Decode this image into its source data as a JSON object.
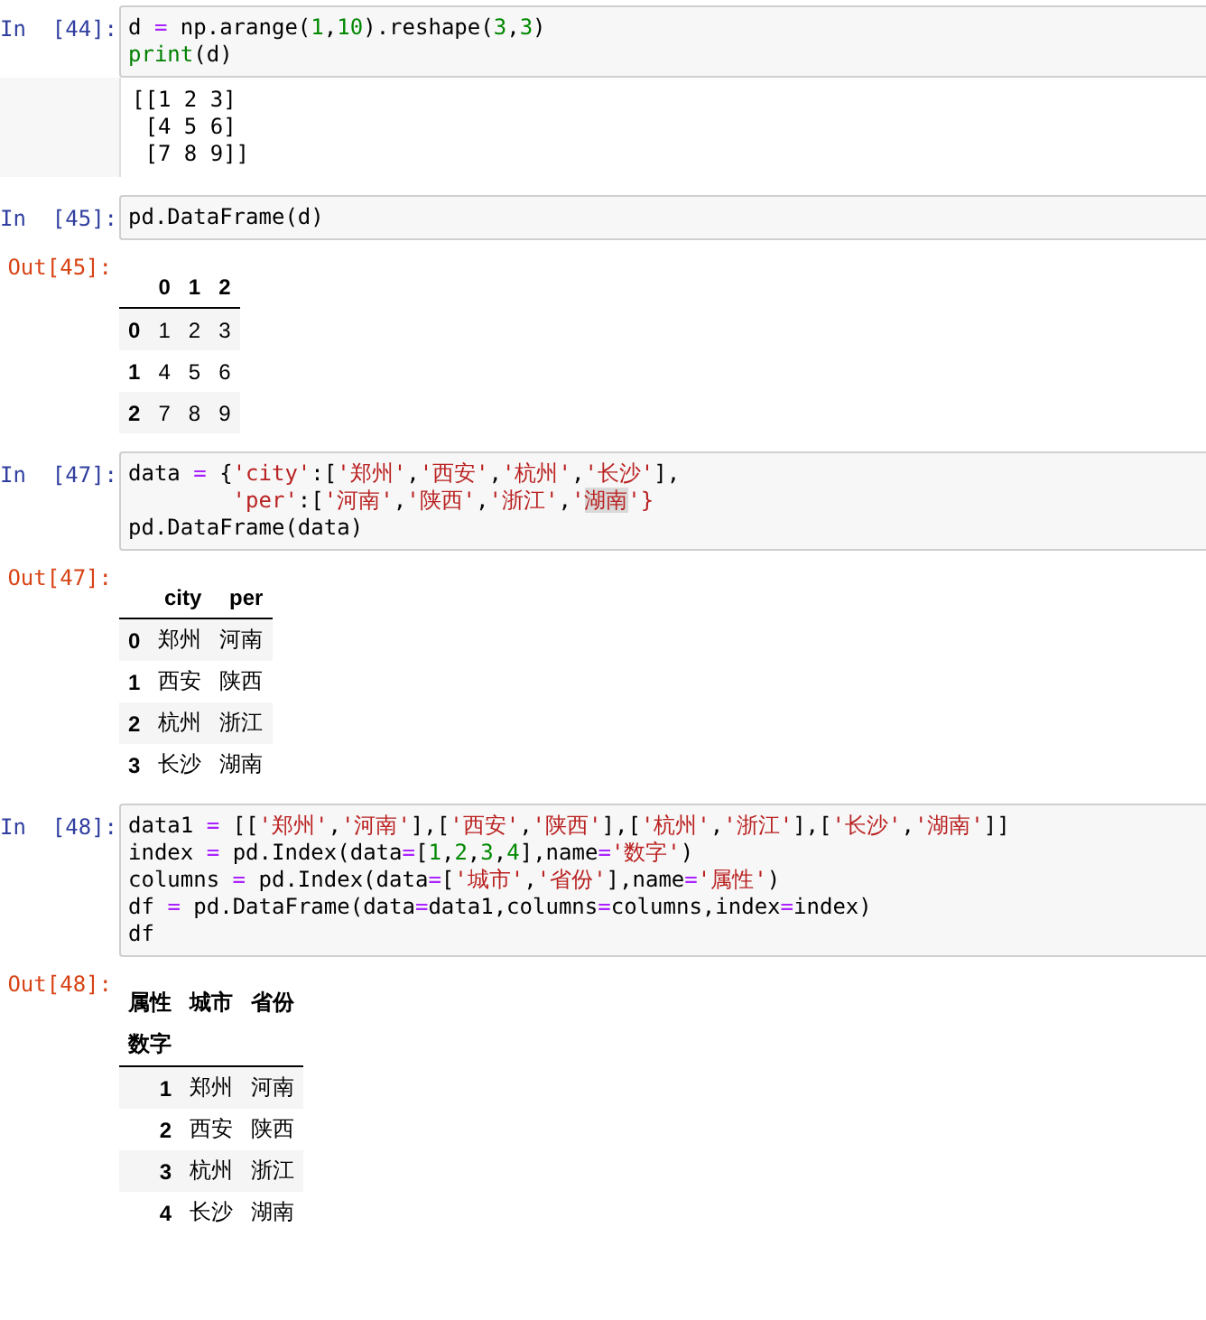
{
  "cells": [
    {
      "in_prompt": "In  [44]:",
      "code": [
        [
          {
            "kind": "plain",
            "text": "d "
          },
          {
            "kind": "op",
            "text": "="
          },
          {
            "kind": "plain",
            "text": " np.arange("
          },
          {
            "kind": "num",
            "text": "1"
          },
          {
            "kind": "plain",
            "text": ","
          },
          {
            "kind": "num",
            "text": "10"
          },
          {
            "kind": "plain",
            "text": ").reshape("
          },
          {
            "kind": "num",
            "text": "3"
          },
          {
            "kind": "plain",
            "text": ","
          },
          {
            "kind": "num",
            "text": "3"
          },
          {
            "kind": "plain",
            "text": ")"
          }
        ],
        [
          {
            "kind": "builtin",
            "text": "print"
          },
          {
            "kind": "plain",
            "text": "(d)"
          }
        ]
      ],
      "output": {
        "kind": "stream",
        "lines": [
          "[[1 2 3]",
          " [4 5 6]",
          " [7 8 9]]"
        ]
      }
    },
    {
      "in_prompt": "In  [45]:",
      "code": [
        [
          {
            "kind": "plain",
            "text": "pd.DataFrame(d)"
          }
        ]
      ],
      "output": {
        "kind": "table",
        "out_prompt": "Out[45]:",
        "header_rows": [
          [
            "0",
            "1",
            "2"
          ]
        ],
        "rows": [
          {
            "index": "0",
            "cells": [
              "1",
              "2",
              "3"
            ]
          },
          {
            "index": "1",
            "cells": [
              "4",
              "5",
              "6"
            ]
          },
          {
            "index": "2",
            "cells": [
              "7",
              "8",
              "9"
            ]
          }
        ]
      }
    },
    {
      "in_prompt": "In  [47]:",
      "code": [
        [
          {
            "kind": "plain",
            "text": "data "
          },
          {
            "kind": "op",
            "text": "="
          },
          {
            "kind": "plain",
            "text": " {"
          },
          {
            "kind": "str",
            "text": "'city'"
          },
          {
            "kind": "plain",
            "text": ":["
          },
          {
            "kind": "str",
            "text": "'郑州'"
          },
          {
            "kind": "plain",
            "text": ","
          },
          {
            "kind": "str",
            "text": "'西安'"
          },
          {
            "kind": "plain",
            "text": ","
          },
          {
            "kind": "str",
            "text": "'杭州'"
          },
          {
            "kind": "plain",
            "text": ","
          },
          {
            "kind": "str",
            "text": "'长沙'"
          },
          {
            "kind": "plain",
            "text": "],"
          }
        ],
        [
          {
            "kind": "str",
            "text": "        'per'"
          },
          {
            "kind": "plain",
            "text": ":["
          },
          {
            "kind": "str",
            "text": "'河南'"
          },
          {
            "kind": "plain",
            "text": ","
          },
          {
            "kind": "str",
            "text": "'陕西'"
          },
          {
            "kind": "plain",
            "text": ","
          },
          {
            "kind": "str",
            "text": "'浙江'"
          },
          {
            "kind": "plain",
            "text": ","
          },
          {
            "kind": "str",
            "text": "'"
          },
          {
            "kind": "selection",
            "text": "湖南"
          },
          {
            "kind": "str",
            "text": "'}"
          }
        ],
        [
          {
            "kind": "plain",
            "text": "pd.DataFrame(data)"
          }
        ]
      ],
      "output": {
        "kind": "table",
        "out_prompt": "Out[47]:",
        "header_rows": [
          [
            "city",
            "per"
          ]
        ],
        "rows": [
          {
            "index": "0",
            "cells": [
              "郑州",
              "河南"
            ]
          },
          {
            "index": "1",
            "cells": [
              "西安",
              "陕西"
            ]
          },
          {
            "index": "2",
            "cells": [
              "杭州",
              "浙江"
            ]
          },
          {
            "index": "3",
            "cells": [
              "长沙",
              "湖南"
            ]
          }
        ]
      }
    },
    {
      "in_prompt": "In  [48]:",
      "code": [
        [
          {
            "kind": "plain",
            "text": "data1 "
          },
          {
            "kind": "op",
            "text": "="
          },
          {
            "kind": "plain",
            "text": " [["
          },
          {
            "kind": "str",
            "text": "'郑州'"
          },
          {
            "kind": "plain",
            "text": ","
          },
          {
            "kind": "str",
            "text": "'河南'"
          },
          {
            "kind": "plain",
            "text": "],["
          },
          {
            "kind": "str",
            "text": "'西安'"
          },
          {
            "kind": "plain",
            "text": ","
          },
          {
            "kind": "str",
            "text": "'陕西'"
          },
          {
            "kind": "plain",
            "text": "],["
          },
          {
            "kind": "str",
            "text": "'杭州'"
          },
          {
            "kind": "plain",
            "text": ","
          },
          {
            "kind": "str",
            "text": "'浙江'"
          },
          {
            "kind": "plain",
            "text": "],["
          },
          {
            "kind": "str",
            "text": "'长沙'"
          },
          {
            "kind": "plain",
            "text": ","
          },
          {
            "kind": "str",
            "text": "'湖南'"
          },
          {
            "kind": "plain",
            "text": "]]"
          }
        ],
        [
          {
            "kind": "plain",
            "text": "index "
          },
          {
            "kind": "op",
            "text": "="
          },
          {
            "kind": "plain",
            "text": " pd.Index(data"
          },
          {
            "kind": "op",
            "text": "="
          },
          {
            "kind": "plain",
            "text": "["
          },
          {
            "kind": "num",
            "text": "1"
          },
          {
            "kind": "plain",
            "text": ","
          },
          {
            "kind": "num",
            "text": "2"
          },
          {
            "kind": "plain",
            "text": ","
          },
          {
            "kind": "num",
            "text": "3"
          },
          {
            "kind": "plain",
            "text": ","
          },
          {
            "kind": "num",
            "text": "4"
          },
          {
            "kind": "plain",
            "text": "],name"
          },
          {
            "kind": "op",
            "text": "="
          },
          {
            "kind": "str",
            "text": "'数字'"
          },
          {
            "kind": "plain",
            "text": ")"
          }
        ],
        [
          {
            "kind": "plain",
            "text": "columns "
          },
          {
            "kind": "op",
            "text": "="
          },
          {
            "kind": "plain",
            "text": " pd.Index(data"
          },
          {
            "kind": "op",
            "text": "="
          },
          {
            "kind": "plain",
            "text": "["
          },
          {
            "kind": "str",
            "text": "'城市'"
          },
          {
            "kind": "plain",
            "text": ","
          },
          {
            "kind": "str",
            "text": "'省份'"
          },
          {
            "kind": "plain",
            "text": "],name"
          },
          {
            "kind": "op",
            "text": "="
          },
          {
            "kind": "str",
            "text": "'属性'"
          },
          {
            "kind": "plain",
            "text": ")"
          }
        ],
        [
          {
            "kind": "plain",
            "text": "df "
          },
          {
            "kind": "op",
            "text": "="
          },
          {
            "kind": "plain",
            "text": " pd.DataFrame(data"
          },
          {
            "kind": "op",
            "text": "="
          },
          {
            "kind": "plain",
            "text": "data1,columns"
          },
          {
            "kind": "op",
            "text": "="
          },
          {
            "kind": "plain",
            "text": "columns,index"
          },
          {
            "kind": "op",
            "text": "="
          },
          {
            "kind": "plain",
            "text": "index)"
          }
        ],
        [
          {
            "kind": "plain",
            "text": "df"
          }
        ]
      ],
      "output": {
        "kind": "table",
        "out_prompt": "Out[48]:",
        "header_rows": [
          [
            "属性",
            "城市",
            "省份"
          ],
          [
            "数字"
          ]
        ],
        "rows": [
          {
            "index": "1",
            "cells": [
              "郑州",
              "河南"
            ]
          },
          {
            "index": "2",
            "cells": [
              "西安",
              "陕西"
            ]
          },
          {
            "index": "3",
            "cells": [
              "杭州",
              "浙江"
            ]
          },
          {
            "index": "4",
            "cells": [
              "长沙",
              "湖南"
            ]
          }
        ]
      }
    }
  ]
}
